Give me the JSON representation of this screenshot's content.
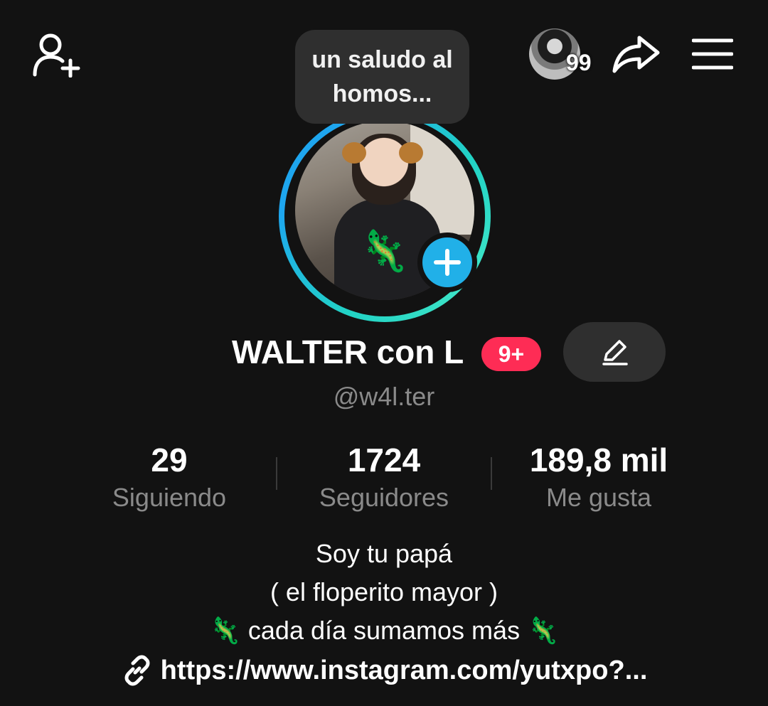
{
  "header": {
    "note": "un saludo al homos...",
    "visitors_count": "99"
  },
  "profile": {
    "display_name": "WALTER con L",
    "notification_badge": "9+",
    "username": "@w4l.ter",
    "avatar_emoji": "🦎"
  },
  "stats": [
    {
      "value": "29",
      "label": "Siguiendo"
    },
    {
      "value": "1724",
      "label": "Seguidores"
    },
    {
      "value": "189,8 mil",
      "label": "Me gusta"
    }
  ],
  "bio": {
    "lines": [
      "Soy tu papá",
      "( el floperito mayor )",
      "🦎 cada día sumamos más 🦎"
    ],
    "link": "https://www.instagram.com/yutxpo?..."
  },
  "colors": {
    "background": "#121212",
    "badge": "#fe2c55",
    "add_button": "#21b0e8",
    "secondary_text": "#8a8a8a"
  }
}
